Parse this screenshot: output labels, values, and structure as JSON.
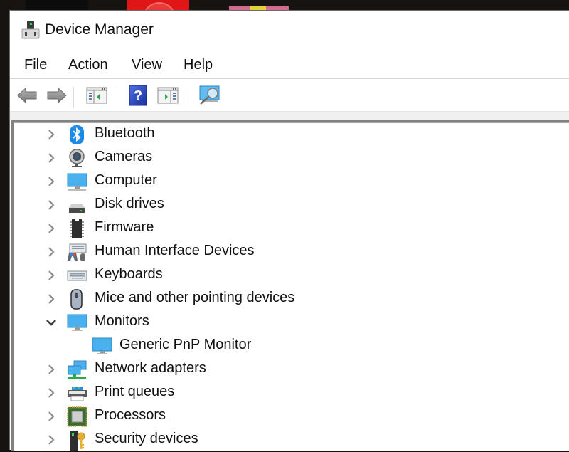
{
  "window": {
    "title": "Device Manager",
    "title_icon": "device-manager-icon"
  },
  "menu": {
    "items": [
      {
        "label": "File"
      },
      {
        "label": "Action"
      },
      {
        "label": "View"
      },
      {
        "label": "Help"
      }
    ]
  },
  "toolbar": {
    "buttons": [
      {
        "name": "back-button",
        "icon": "arrow-left-icon",
        "enabled": false
      },
      {
        "name": "forward-button",
        "icon": "arrow-right-icon",
        "enabled": false
      },
      {
        "name": "show-hide-console-tree-button",
        "icon": "console-tree-icon"
      },
      {
        "name": "help-button",
        "icon": "help-icon"
      },
      {
        "name": "show-hide-action-pane-button",
        "icon": "action-pane-icon"
      },
      {
        "name": "scan-hardware-changes-button",
        "icon": "scan-monitor-icon"
      }
    ]
  },
  "tree": {
    "items": [
      {
        "label": "Bluetooth",
        "icon": "bluetooth-icon",
        "expanded": false,
        "level": 0
      },
      {
        "label": "Cameras",
        "icon": "camera-icon",
        "expanded": false,
        "level": 0
      },
      {
        "label": "Computer",
        "icon": "computer-icon",
        "expanded": false,
        "level": 0
      },
      {
        "label": "Disk drives",
        "icon": "disk-drive-icon",
        "expanded": false,
        "level": 0
      },
      {
        "label": "Firmware",
        "icon": "firmware-chip-icon",
        "expanded": false,
        "level": 0
      },
      {
        "label": "Human Interface Devices",
        "icon": "hid-icon",
        "expanded": false,
        "level": 0
      },
      {
        "label": "Keyboards",
        "icon": "keyboard-icon",
        "expanded": false,
        "level": 0
      },
      {
        "label": "Mice and other pointing devices",
        "icon": "mouse-icon",
        "expanded": false,
        "level": 0
      },
      {
        "label": "Monitors",
        "icon": "monitor-icon",
        "expanded": true,
        "level": 0
      },
      {
        "label": "Generic PnP Monitor",
        "icon": "monitor-icon",
        "level": 1
      },
      {
        "label": "Network adapters",
        "icon": "network-adapter-icon",
        "expanded": false,
        "level": 0
      },
      {
        "label": "Print queues",
        "icon": "printer-icon",
        "expanded": false,
        "level": 0
      },
      {
        "label": "Processors",
        "icon": "processor-icon",
        "expanded": false,
        "level": 0
      },
      {
        "label": "Security devices",
        "icon": "security-device-icon",
        "expanded": false,
        "level": 0
      }
    ]
  },
  "colors": {
    "accent_blue": "#1e8ce6",
    "monitor_blue": "#4ab0ee"
  }
}
